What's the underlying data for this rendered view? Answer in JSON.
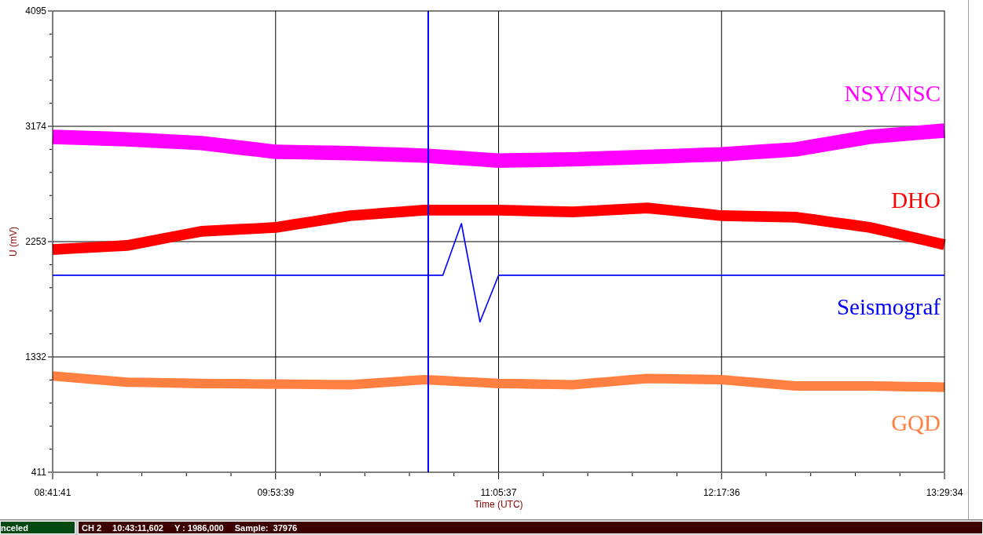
{
  "chart_data": {
    "type": "line",
    "xlabel": "Time (UTC)",
    "ylabel": "U (mV)",
    "categories": [
      "08:41:41",
      null,
      null,
      null,
      null,
      null,
      null,
      null,
      null,
      null,
      null,
      null,
      "09:53:39",
      null,
      null,
      null,
      null,
      null,
      null,
      null,
      null,
      null,
      null,
      null,
      "11:05:37",
      null,
      null,
      null,
      null,
      null,
      null,
      null,
      null,
      null,
      null,
      null,
      "12:17:36",
      null,
      null,
      null,
      null,
      null,
      null,
      null,
      null,
      null,
      null,
      null,
      "13:29:34"
    ],
    "ylim": [
      411,
      4095
    ],
    "yticks": [
      411,
      1332,
      2253,
      3174,
      4095
    ],
    "series": [
      {
        "name": "NSY/NSC",
        "color": "#ff00ff",
        "values": [
          3090,
          3085,
          3080,
          3075,
          3070,
          3063,
          3055,
          3048,
          3040,
          3023,
          3005,
          2988,
          2970,
          2968,
          2965,
          2963,
          2960,
          2955,
          2950,
          2945,
          2940,
          2930,
          2920,
          2910,
          2900,
          2903,
          2905,
          2908,
          2910,
          2915,
          2920,
          2925,
          2930,
          2935,
          2940,
          2945,
          2950,
          2960,
          2970,
          2980,
          2990,
          3015,
          3040,
          3065,
          3090,
          3103,
          3115,
          3128,
          3140
        ]
      },
      {
        "name": "DHO",
        "color": "#ff0000",
        "values": [
          2190,
          2198,
          2206,
          2214,
          2222,
          2250,
          2279,
          2307,
          2335,
          2343,
          2351,
          2358,
          2366,
          2390,
          2413,
          2437,
          2460,
          2471,
          2482,
          2493,
          2504,
          2504,
          2504,
          2504,
          2504,
          2501,
          2497,
          2494,
          2490,
          2498,
          2506,
          2514,
          2522,
          2507,
          2491,
          2476,
          2460,
          2457,
          2454,
          2451,
          2448,
          2428,
          2407,
          2387,
          2366,
          2332,
          2297,
          2263,
          2228
        ]
      },
      {
        "name": "Seismograf",
        "color": "#0000ff",
        "values": [
          1984,
          1984,
          1984,
          1984,
          1984,
          1984,
          1984,
          1984,
          1984,
          1984,
          1984,
          1984,
          1984,
          1984,
          1984,
          1984,
          1984,
          1984,
          1984,
          1984,
          1984,
          1984,
          2397,
          1612,
          1984,
          1984,
          1984,
          1984,
          1984,
          1984,
          1984,
          1984,
          1984,
          1984,
          1984,
          1984,
          1984,
          1984,
          1984,
          1984,
          1984,
          1984,
          1984,
          1984,
          1984,
          1984,
          1984,
          1984,
          1984
        ]
      },
      {
        "name": "GQD",
        "color": "#ff8040",
        "values": [
          1180,
          1168,
          1155,
          1143,
          1130,
          1128,
          1125,
          1123,
          1120,
          1119,
          1118,
          1116,
          1115,
          1114,
          1113,
          1111,
          1110,
          1120,
          1130,
          1140,
          1150,
          1143,
          1135,
          1128,
          1120,
          1118,
          1115,
          1113,
          1110,
          1123,
          1135,
          1148,
          1160,
          1158,
          1155,
          1153,
          1150,
          1138,
          1125,
          1113,
          1100,
          1100,
          1100,
          1100,
          1100,
          1098,
          1095,
          1093,
          1090
        ]
      }
    ],
    "grid": true
  },
  "status_bar": {
    "state": "nceled",
    "channel": "CH 2",
    "time": "10:43:11,602",
    "y_value": "Y : 1986,000",
    "sample": "Sample:  37976"
  }
}
